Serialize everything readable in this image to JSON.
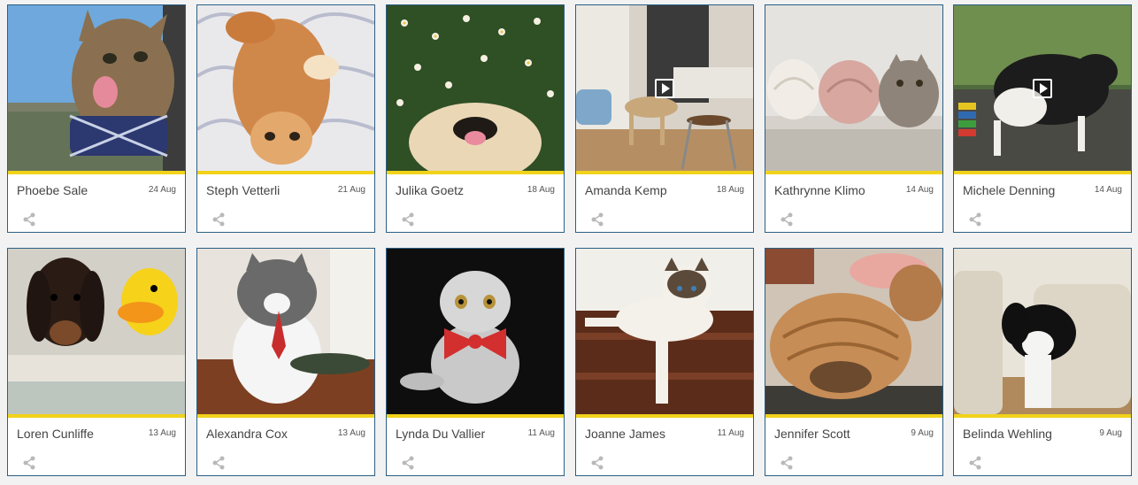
{
  "cards": [
    {
      "name": "Phoebe Sale",
      "date": "24 Aug",
      "photo": "cat-with-bowtie-licking",
      "video": false
    },
    {
      "name": "Steph Vetterli",
      "date": "21 Aug",
      "photo": "orange-cat-upside-down",
      "video": false
    },
    {
      "name": "Julika Goetz",
      "date": "18 Aug",
      "photo": "dog-in-flowers",
      "video": false
    },
    {
      "name": "Amanda Kemp",
      "date": "18 Aug",
      "photo": "dog-in-kitchen",
      "video": true
    },
    {
      "name": "Kathrynne Klimo",
      "date": "14 Aug",
      "photo": "cat-with-towels",
      "video": false
    },
    {
      "name": "Michele Denning",
      "date": "14 Aug",
      "photo": "dog-on-patio",
      "video": true
    },
    {
      "name": "Loren Cunliffe",
      "date": "13 Aug",
      "photo": "dachshund-with-duck",
      "video": false
    },
    {
      "name": "Alexandra Cox",
      "date": "13 Aug",
      "photo": "cat-with-red-tie",
      "video": false
    },
    {
      "name": "Lynda Du Vallier",
      "date": "11 Aug",
      "photo": "kitten-with-red-bowtie",
      "video": false
    },
    {
      "name": "Joanne James",
      "date": "11 Aug",
      "photo": "ragdoll-cat-on-stairs",
      "video": false
    },
    {
      "name": "Jennifer Scott",
      "date": "9 Aug",
      "photo": "shar-pei-puppy",
      "video": false
    },
    {
      "name": "Belinda Wehling",
      "date": "9 Aug",
      "photo": "puppy-on-sofa",
      "video": false
    }
  ],
  "colors": {
    "card_border": "#2b5f84",
    "accent_bar": "#f1d21a",
    "share_icon": "#b9b9b9"
  }
}
